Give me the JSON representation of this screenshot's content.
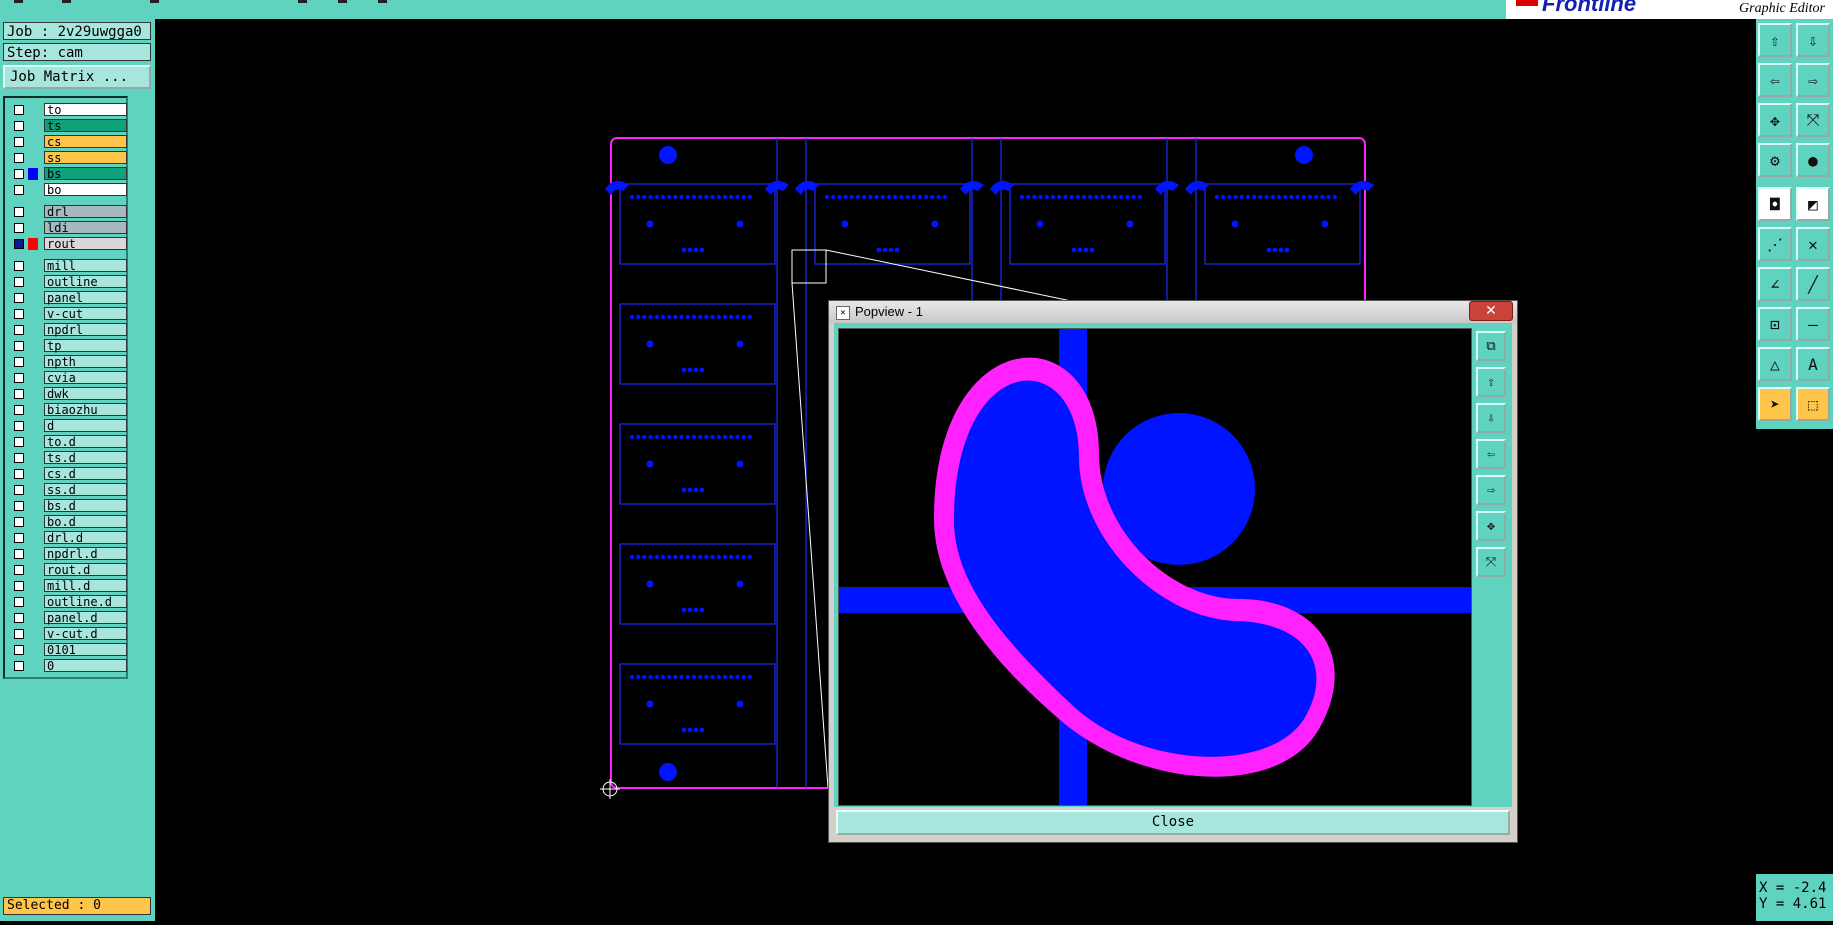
{
  "app": {
    "brand_title": "Frontline",
    "subtitle": "Graphic Editor"
  },
  "job_panel": {
    "job": "Job : 2v29uwgga0",
    "step": "Step: cam",
    "matrix_button": "Job Matrix ...",
    "selected": "Selected : 0"
  },
  "layers": [
    {
      "name": "to",
      "color": "#ffffff"
    },
    {
      "name": "ts",
      "color": "#0fa27a"
    },
    {
      "name": "cs",
      "color": "#ffc54a"
    },
    {
      "name": "ss",
      "color": "#ffc54a"
    },
    {
      "name": "bs",
      "color": "#0fa27a",
      "swatch": "#0000ff"
    },
    {
      "name": "bo",
      "color": "#ffffff"
    },
    {
      "name": "drl",
      "color": "#a6b8c0"
    },
    {
      "name": "ldi",
      "color": "#a6b8c0"
    },
    {
      "name": "rout",
      "color": "#d8d8d8",
      "swatch": "#ff0000",
      "active": true
    },
    {
      "name": "mill"
    },
    {
      "name": "outline"
    },
    {
      "name": "panel"
    },
    {
      "name": "v-cut"
    },
    {
      "name": "npdrl"
    },
    {
      "name": "tp"
    },
    {
      "name": "npth"
    },
    {
      "name": "cvia"
    },
    {
      "name": "dwk"
    },
    {
      "name": "biaozhu"
    },
    {
      "name": "d"
    },
    {
      "name": "to.d"
    },
    {
      "name": "ts.d"
    },
    {
      "name": "cs.d"
    },
    {
      "name": "ss.d"
    },
    {
      "name": "bs.d"
    },
    {
      "name": "bo.d"
    },
    {
      "name": "drl.d"
    },
    {
      "name": "npdrl.d"
    },
    {
      "name": "rout.d"
    },
    {
      "name": "mill.d"
    },
    {
      "name": "outline.d"
    },
    {
      "name": "panel.d"
    },
    {
      "name": "v-cut.d"
    },
    {
      "name": "0101"
    },
    {
      "name": "0"
    }
  ],
  "popup": {
    "title": "Popview - 1",
    "close_x": "✕",
    "close_label": "Close"
  },
  "coords": {
    "x": "X = -2.4",
    "y": "Y = 4.61"
  },
  "colors": {
    "accent": "#5fd3bf",
    "pad_blue": "#0014ff",
    "outline_magenta": "#ff22ff"
  }
}
